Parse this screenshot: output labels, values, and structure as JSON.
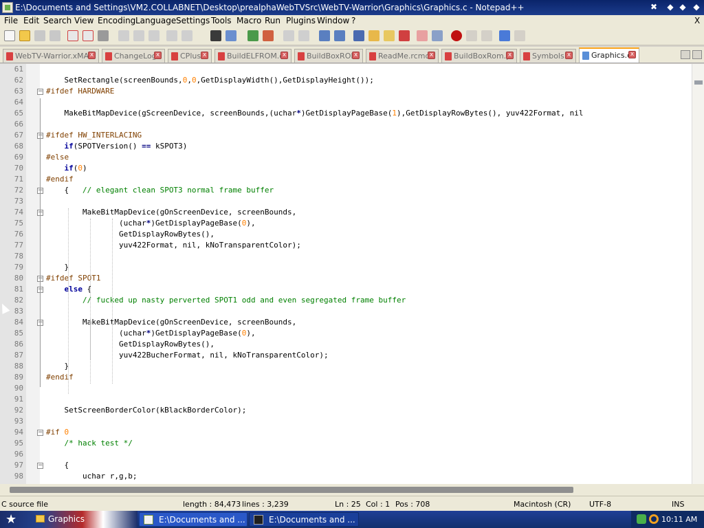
{
  "window": {
    "title": "E:\\Documents and Settings\\VM2.COLLABNET\\Desktop\\prealphaWebTVSrc\\WebTV-Warrior\\Graphics\\Graphics.c - Notepad++",
    "close_glyph": "✖",
    "minimize_glyph": "‒",
    "maximize_glyph": "□",
    "restore_glyph": "◆",
    "doc_close_glyph": "X"
  },
  "menu": [
    "File",
    "Edit",
    "Search",
    "View",
    "Encoding",
    "Language",
    "Settings",
    "Tools",
    "Macro",
    "Run",
    "Plugins",
    "Window",
    "?"
  ],
  "tabs": [
    {
      "label": "WebTV-Warrior.xMAP",
      "active": false
    },
    {
      "label": "ChangeLog",
      "active": false
    },
    {
      "label": "CPlus",
      "active": false
    },
    {
      "label": "BuildELFROM.c",
      "active": false
    },
    {
      "label": "BuildBoxROM",
      "active": false
    },
    {
      "label": "ReadMe.rcmd",
      "active": false
    },
    {
      "label": "BuildBoxRom.pl",
      "active": false
    },
    {
      "label": "Symbols.h",
      "active": false
    },
    {
      "label": "Graphics.c",
      "active": true
    }
  ],
  "tab_close_glyph": "x",
  "code_lines": [
    {
      "n": "61",
      "t": ""
    },
    {
      "n": "62",
      "t": "    SetRectangle(screenBounds,0,0,GetDisplayWidth(),GetDisplayHeight());"
    },
    {
      "n": "63",
      "t": "#ifdef HARDWARE"
    },
    {
      "n": "64",
      "t": ""
    },
    {
      "n": "65",
      "t": "    MakeBitMapDevice(gScreenDevice, screenBounds,(uchar*)GetDisplayPageBase(1),GetDisplayRowBytes(), yuv422Format, nil"
    },
    {
      "n": "66",
      "t": ""
    },
    {
      "n": "67",
      "t": "#ifdef HW_INTERLACING"
    },
    {
      "n": "68",
      "t": "    if(SPOTVersion() == kSPOT3)"
    },
    {
      "n": "69",
      "t": "#else"
    },
    {
      "n": "70",
      "t": "    if(0)"
    },
    {
      "n": "71",
      "t": "#endif"
    },
    {
      "n": "72",
      "t": "    {   // elegant clean SPOT3 normal frame buffer"
    },
    {
      "n": "73",
      "t": ""
    },
    {
      "n": "74",
      "t": "        MakeBitMapDevice(gOnScreenDevice, screenBounds,"
    },
    {
      "n": "75",
      "t": "                (uchar*)GetDisplayPageBase(0),"
    },
    {
      "n": "76",
      "t": "                GetDisplayRowBytes(),"
    },
    {
      "n": "77",
      "t": "                yuv422Format, nil, kNoTransparentColor);"
    },
    {
      "n": "78",
      "t": ""
    },
    {
      "n": "79",
      "t": "    }"
    },
    {
      "n": "80",
      "t": "#ifdef SPOT1"
    },
    {
      "n": "81",
      "t": "    else {"
    },
    {
      "n": "82",
      "t": "        // fucked up nasty perverted SPOT1 odd and even segregated frame buffer"
    },
    {
      "n": "83",
      "t": ""
    },
    {
      "n": "84",
      "t": "        MakeBitMapDevice(gOnScreenDevice, screenBounds,"
    },
    {
      "n": "85",
      "t": "                (uchar*)GetDisplayPageBase(0),"
    },
    {
      "n": "86",
      "t": "                GetDisplayRowBytes(),"
    },
    {
      "n": "87",
      "t": "                yuv422BucherFormat, nil, kNoTransparentColor);"
    },
    {
      "n": "88",
      "t": "    }"
    },
    {
      "n": "89",
      "t": "#endif"
    },
    {
      "n": "90",
      "t": ""
    },
    {
      "n": "91",
      "t": ""
    },
    {
      "n": "92",
      "t": "    SetScreenBorderColor(kBlackBorderColor);"
    },
    {
      "n": "93",
      "t": ""
    },
    {
      "n": "94",
      "t": "#if 0"
    },
    {
      "n": "95",
      "t": "    /* hack test */"
    },
    {
      "n": "96",
      "t": ""
    },
    {
      "n": "97",
      "t": "    {"
    },
    {
      "n": "98",
      "t": "        uchar r,g,b;"
    }
  ],
  "fold_markers": [
    "63",
    "67",
    "72",
    "74",
    "80",
    "81",
    "84",
    "94",
    "97"
  ],
  "status": {
    "file_type": "C source file",
    "length": "length : 84,473",
    "lines": "lines : 3,239",
    "ln": "Ln : 25",
    "col": "Col : 1",
    "pos": "Pos : 708",
    "eol": "Macintosh (CR)",
    "encoding": "UTF-8",
    "mode": "INS"
  },
  "taskbar": {
    "start_folder": "Graphics",
    "tasks": [
      {
        "label": "E:\\Documents and ...",
        "icon": "notepad-icon"
      },
      {
        "label": "E:\\Documents and ...",
        "icon": "console-icon"
      }
    ],
    "clock": "10:11 AM"
  },
  "colors": {
    "titlebar": "#0a246a",
    "preprocessor": "#804000",
    "keyword": "#00009a",
    "number": "#ff8000",
    "comment": "#008000",
    "active_tab_accent": "#f9a21a"
  }
}
